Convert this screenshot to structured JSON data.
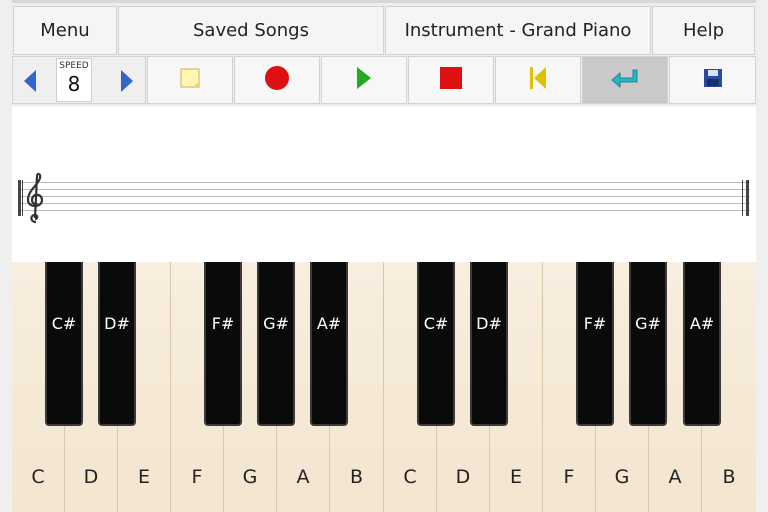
{
  "menu": {
    "menu_label": "Menu",
    "saved_songs_label": "Saved Songs",
    "instrument_label": "Instrument - Grand Piano",
    "help_label": "Help"
  },
  "toolbar": {
    "speed_label": "SPEED",
    "speed_value": "8",
    "icons": [
      "prev-arrow-icon",
      "next-arrow-icon",
      "new-song-icon",
      "record-icon",
      "play-icon",
      "stop-icon",
      "rewind-to-start-icon",
      "enter-return-icon",
      "save-floppy-icon"
    ],
    "colors": {
      "arrow": "#3366cc",
      "record": "#dd1111",
      "play": "#22aa22",
      "stop": "#dd1111",
      "rewind": "#e0c000",
      "enter": "#22b8c8",
      "save": "#2a4aa0"
    }
  },
  "keyboard": {
    "white_keys": [
      "C",
      "D",
      "E",
      "F",
      "G",
      "A",
      "B",
      "C",
      "D",
      "E",
      "F",
      "G",
      "A",
      "B"
    ],
    "black_keys": [
      "C#",
      "D#",
      "F#",
      "G#",
      "A#",
      "C#",
      "D#",
      "F#",
      "G#",
      "A#"
    ]
  }
}
